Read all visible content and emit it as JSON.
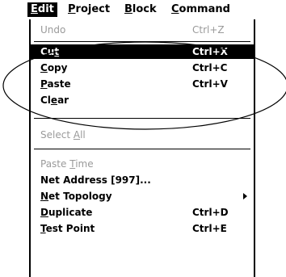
{
  "menubar": {
    "items": [
      {
        "label": "Edit",
        "mnemonic": "E"
      },
      {
        "label": "Project",
        "mnemonic": "P"
      },
      {
        "label": "Block",
        "mnemonic": "B"
      },
      {
        "label": "Command",
        "mnemonic": "C"
      }
    ]
  },
  "menu": {
    "undo": {
      "label": "Undo",
      "shortcut": "Ctrl+Z"
    },
    "cut": {
      "label_pre": "Cu",
      "label_mn": "t",
      "shortcut": "Ctrl+X"
    },
    "copy": {
      "label_mn": "C",
      "label_post": "opy",
      "shortcut": "Ctrl+C"
    },
    "paste": {
      "label_mn": "P",
      "label_post": "aste",
      "shortcut": "Ctrl+V"
    },
    "clear": {
      "label_pre": "Cl",
      "label_mn": "e",
      "label_post": "ar"
    },
    "select_all": {
      "label_pre": "Select ",
      "label_mn": "A",
      "label_post": "ll"
    },
    "paste_time": {
      "label_pre": "Paste ",
      "label_mn": "T",
      "label_post": "ime"
    },
    "net_address": {
      "label": "Net Address [997]..."
    },
    "net_topology": {
      "label_mn": "N",
      "label_post": "et Topology"
    },
    "duplicate": {
      "label_mn": "D",
      "label_post": "uplicate",
      "shortcut": "Ctrl+D"
    },
    "test_point": {
      "label_mn": "T",
      "label_post": "est Point",
      "shortcut": "Ctrl+E"
    }
  }
}
